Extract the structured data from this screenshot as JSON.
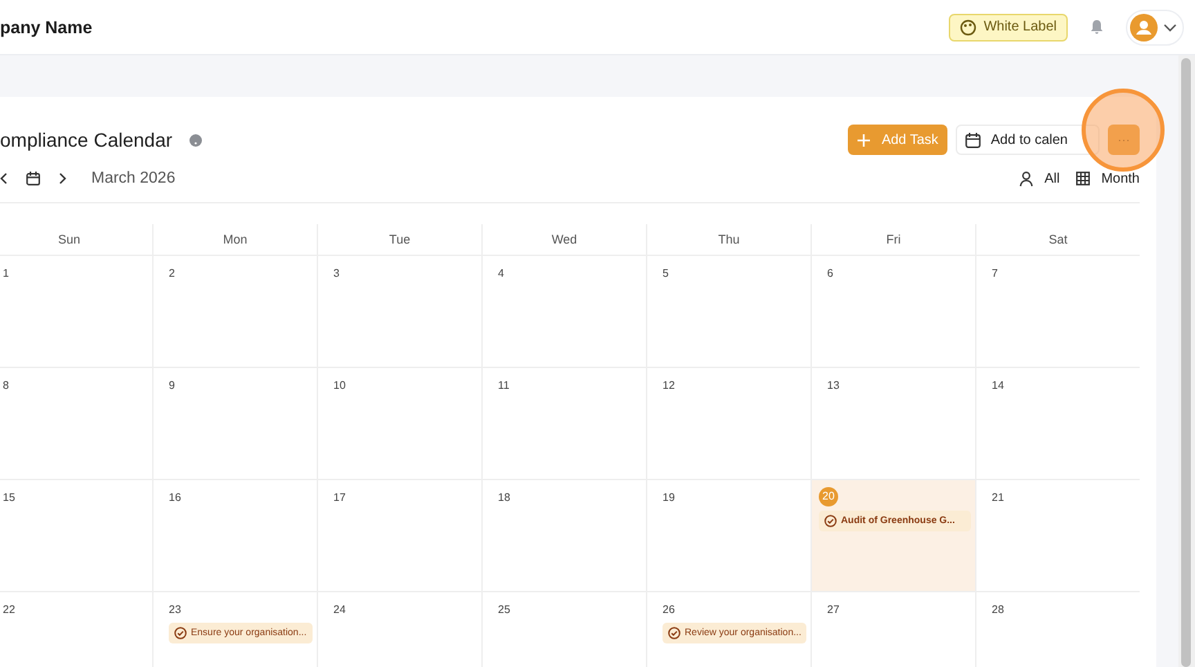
{
  "header": {
    "company": "pany Name",
    "white_label": "White Label"
  },
  "page": {
    "title": "ompliance Calendar",
    "month": "March 2026",
    "add_task": "Add Task",
    "add_to_calendar": "Add to calen",
    "more": "···",
    "filter": "All",
    "view": "Month"
  },
  "calendar": {
    "weekdays": [
      "Sun",
      "Mon",
      "Tue",
      "Wed",
      "Thu",
      "Fri",
      "Sat"
    ],
    "weeks": [
      [
        {
          "date": "1",
          "today": false
        },
        {
          "date": "2",
          "today": false
        },
        {
          "date": "3",
          "today": false
        },
        {
          "date": "4",
          "today": false
        },
        {
          "date": "5",
          "today": false
        },
        {
          "date": "6",
          "today": false
        },
        {
          "date": "7",
          "today": false
        }
      ],
      [
        {
          "date": "8",
          "today": false
        },
        {
          "date": "9",
          "today": false
        },
        {
          "date": "10",
          "today": false
        },
        {
          "date": "11",
          "today": false
        },
        {
          "date": "12",
          "today": false
        },
        {
          "date": "13",
          "today": false
        },
        {
          "date": "14",
          "today": false
        }
      ],
      [
        {
          "date": "15",
          "today": false
        },
        {
          "date": "16",
          "today": false
        },
        {
          "date": "17",
          "today": false
        },
        {
          "date": "18",
          "today": false
        },
        {
          "date": "19",
          "today": false
        },
        {
          "date": "20",
          "today": true,
          "events": [
            {
              "title": "Audit of Greenhouse G..."
            }
          ]
        },
        {
          "date": "21",
          "today": false
        }
      ],
      [
        {
          "date": "22",
          "today": false
        },
        {
          "date": "23",
          "today": false,
          "events": [
            {
              "title": "Ensure your organisation..."
            }
          ]
        },
        {
          "date": "24",
          "today": false
        },
        {
          "date": "25",
          "today": false
        },
        {
          "date": "26",
          "today": false,
          "events": [
            {
              "title": "Review your organisation..."
            }
          ]
        },
        {
          "date": "27",
          "today": false
        },
        {
          "date": "28",
          "today": false
        }
      ]
    ]
  }
}
